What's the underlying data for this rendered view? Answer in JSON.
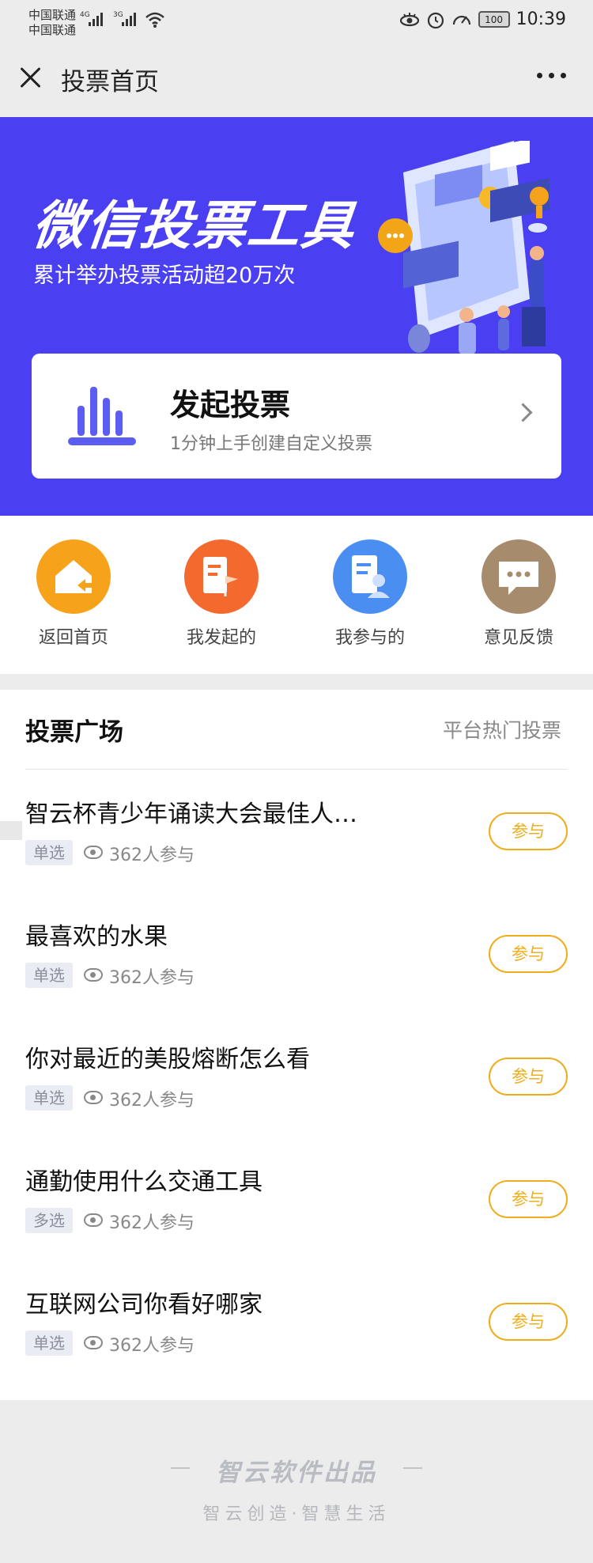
{
  "status_bar": {
    "carrier_1": "中国联通",
    "carrier_2": "中国联通",
    "net_1": "4G",
    "net_2": "3G",
    "battery": "100",
    "time": "10:39"
  },
  "nav": {
    "title": "投票首页"
  },
  "banner": {
    "title": "微信投票工具",
    "subtitle": "累计举办投票活动超20万次",
    "create_title": "发起投票",
    "create_subtitle": "1分钟上手创建自定义投票"
  },
  "quick_nav": [
    {
      "label": "返回首页",
      "icon": "home-icon",
      "color": "#f7a21b"
    },
    {
      "label": "我发起的",
      "icon": "flag-doc-icon",
      "color": "#f46a2e"
    },
    {
      "label": "我参与的",
      "icon": "user-doc-icon",
      "color": "#4a8ef2"
    },
    {
      "label": "意见反馈",
      "icon": "chat-icon",
      "color": "#a68b6c"
    }
  ],
  "square": {
    "title": "投票广场",
    "subtitle": "平台热门投票",
    "join_label": "参与",
    "polls": [
      {
        "title": "智云杯青少年诵读大会最佳人…",
        "tag": "单选",
        "count": "362人参与"
      },
      {
        "title": "最喜欢的水果",
        "tag": "单选",
        "count": "362人参与"
      },
      {
        "title": "你对最近的美股熔断怎么看",
        "tag": "单选",
        "count": "362人参与"
      },
      {
        "title": "通勤使用什么交通工具",
        "tag": "多选",
        "count": "362人参与"
      },
      {
        "title": "互联网公司你看好哪家",
        "tag": "单选",
        "count": "362人参与"
      }
    ]
  },
  "footer": {
    "brand": "智云软件出品",
    "slogan": "智云创造·智慧生活"
  },
  "colors": {
    "banner_bg": "#4a3ff1",
    "accent_orange": "#f0ad1a"
  }
}
